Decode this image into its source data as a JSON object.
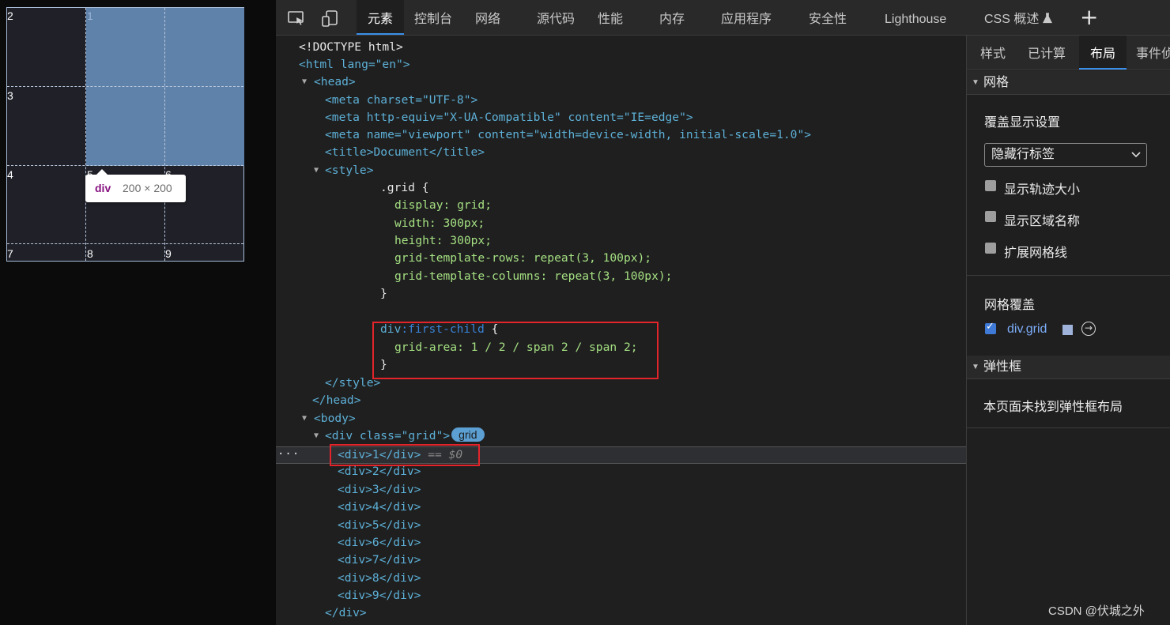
{
  "viewport": {
    "cells": [
      "2",
      "1",
      "3",
      "4",
      "5",
      "6",
      "7",
      "8",
      "9"
    ],
    "tooltip": {
      "tag": "div",
      "size": "200 × 200"
    }
  },
  "tabbar": {
    "tabs": [
      "元素",
      "控制台",
      "网络",
      "源代码",
      "性能",
      "内存",
      "应用程序",
      "安全性",
      "Lighthouse",
      "CSS 概述"
    ],
    "active": "元素",
    "experiment_icon": "flask-icon"
  },
  "dom": {
    "lines": {
      "doctype": "<!DOCTYPE html>",
      "html_open": "<html lang=\"en\">",
      "head_open": "<head>",
      "meta_charset": "<meta charset=\"UTF-8\">",
      "meta_compat": "<meta http-equiv=\"X-UA-Compatible\" content=\"IE=edge\">",
      "meta_viewport": "<meta name=\"viewport\" content=\"width=device-width, initial-scale=1.0\">",
      "title": "<title>Document</title>",
      "style_open": "<style>",
      "css_grid_sel": ".grid {",
      "css_display": "display: grid;",
      "css_width": "width: 300px;",
      "css_height": "height: 300px;",
      "css_rows": "grid-template-rows: repeat(3, 100px);",
      "css_cols": "grid-template-columns: repeat(3, 100px);",
      "css_close1": "}",
      "css_fc_sel_div": "div",
      "css_fc_pseudo": ":first-child",
      "css_fc_brace": " {",
      "css_grid_area": "grid-area: 1 / 2 / span 2 / span 2;",
      "css_close2": "}",
      "style_close": "</style>",
      "head_close": "</head>",
      "body_open": "<body>",
      "div_grid_open": "<div class=\"grid\">",
      "grid_badge": "grid",
      "div_1": "<div>1</div>",
      "selected_marker": "== $0",
      "div_2": "<div>2</div>",
      "div_3": "<div>3</div>",
      "div_4": "<div>4</div>",
      "div_5": "<div>5</div>",
      "div_6": "<div>6</div>",
      "div_7": "<div>7</div>",
      "div_8": "<div>8</div>",
      "div_9": "<div>9</div>",
      "div_close": "</div>"
    }
  },
  "sidebar": {
    "tabs": [
      "样式",
      "已计算",
      "布局",
      "事件侦"
    ],
    "active": "布局",
    "grid_section": {
      "title": "网格",
      "overlay_settings": "覆盖显示设置",
      "select_value": "隐藏行标签",
      "options": [
        {
          "label": "显示轨迹大小",
          "checked": false
        },
        {
          "label": "显示区域名称",
          "checked": false
        },
        {
          "label": "扩展网格线",
          "checked": false
        }
      ],
      "overlays_title": "网格覆盖",
      "overlay_item": {
        "label": "div.grid",
        "checked": true,
        "color": "#9fb2d9"
      }
    },
    "flex_section": {
      "title": "弹性框",
      "empty_text": "本页面未找到弹性框布局"
    }
  },
  "watermark": "CSDN @伏城之外"
}
